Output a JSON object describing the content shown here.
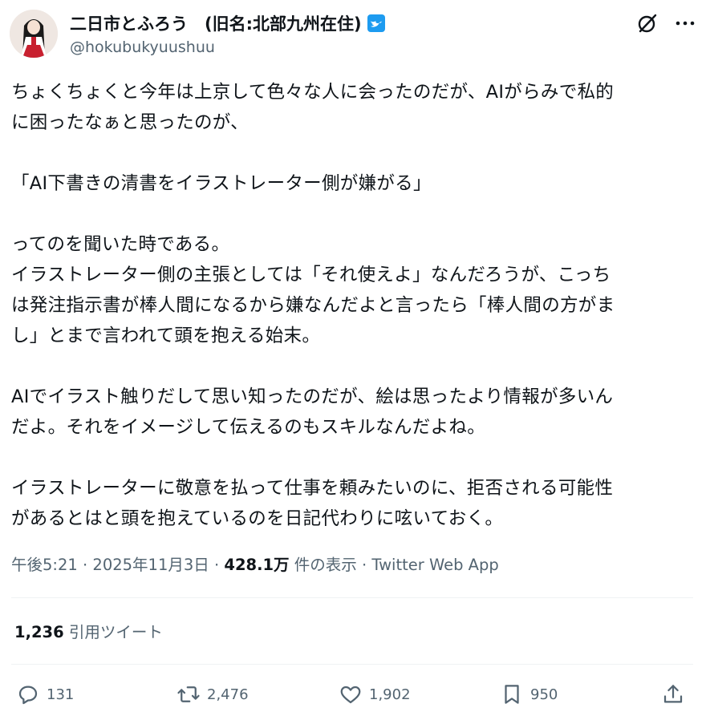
{
  "author": {
    "display_name": "二日市とふろう　(旧名:北部九州在住)",
    "handle": "@hokubukyuushuu",
    "verified": true
  },
  "tweet": {
    "paragraphs": [
      "ちょくちょくと今年は上京して色々な人に会ったのだが、AIがらみで私的",
      "に困ったなぁと思ったのが、",
      "",
      "「AI下書きの清書をイラストレーター側が嫌がる」",
      "",
      "ってのを聞いた時である。",
      "イラストレーター側の主張としては「それ使えよ」なんだろうが、こっち",
      "は発注指示書が棒人間になるから嫌なんだよと言ったら「棒人間の方がま",
      "し」とまで言われて頭を抱える始末。",
      "",
      "AIでイラスト触りだして思い知ったのだが、絵は思ったより情報が多いん",
      "だよ。それをイメージして伝えるのもスキルなんだよね。",
      "",
      "イラストレーターに敬意を払って仕事を頼みたいのに、拒否される可能性",
      "があるとはと頭を抱えているのを日記代わりに呟いておく。"
    ]
  },
  "meta": {
    "time": "午後5:21",
    "date": "2025年11月3日",
    "views_count": "428.1万",
    "views_label": "件の表示",
    "source": "Twitter Web App",
    "separator": " · "
  },
  "quotes": {
    "count": "1,236",
    "label": "引用ツイート"
  },
  "actions": {
    "replies": "131",
    "retweets": "2,476",
    "likes": "1,902",
    "bookmarks": "950"
  },
  "colors": {
    "verified": "#1d9bf0",
    "secondary_text": "#536471",
    "text": "#0f1419",
    "divider": "#eff3f4"
  }
}
